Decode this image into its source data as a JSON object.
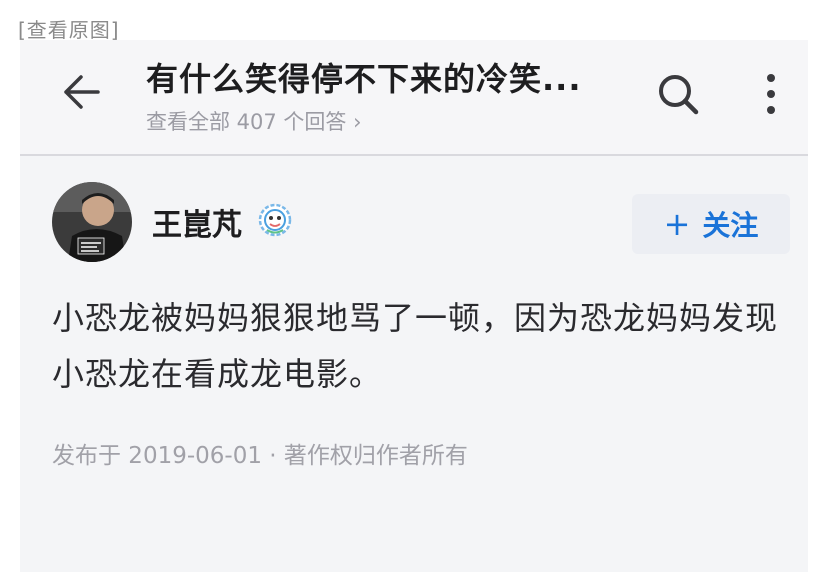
{
  "view_original": "[查看原图]",
  "header": {
    "title": "有什么笑得停不下来的冷笑...",
    "subtitle": "查看全部 407 个回答 ›",
    "icons": [
      "arrow-left-icon",
      "search-icon",
      "more-vertical-icon"
    ]
  },
  "answer": {
    "author": "王崑芃",
    "follow_label": "关注",
    "follow_plus": "+",
    "content": "小恐龙被妈妈狠狠地骂了一顿，因为恐龙妈妈发现小恐龙在看成龙电影。",
    "meta": "发布于 2019-06-01 · 著作权归作者所有"
  },
  "colors": {
    "accent": "#1a73d8",
    "text": "#1d1d1f",
    "muted": "#9b9ba3",
    "background": "#f4f5f7"
  }
}
